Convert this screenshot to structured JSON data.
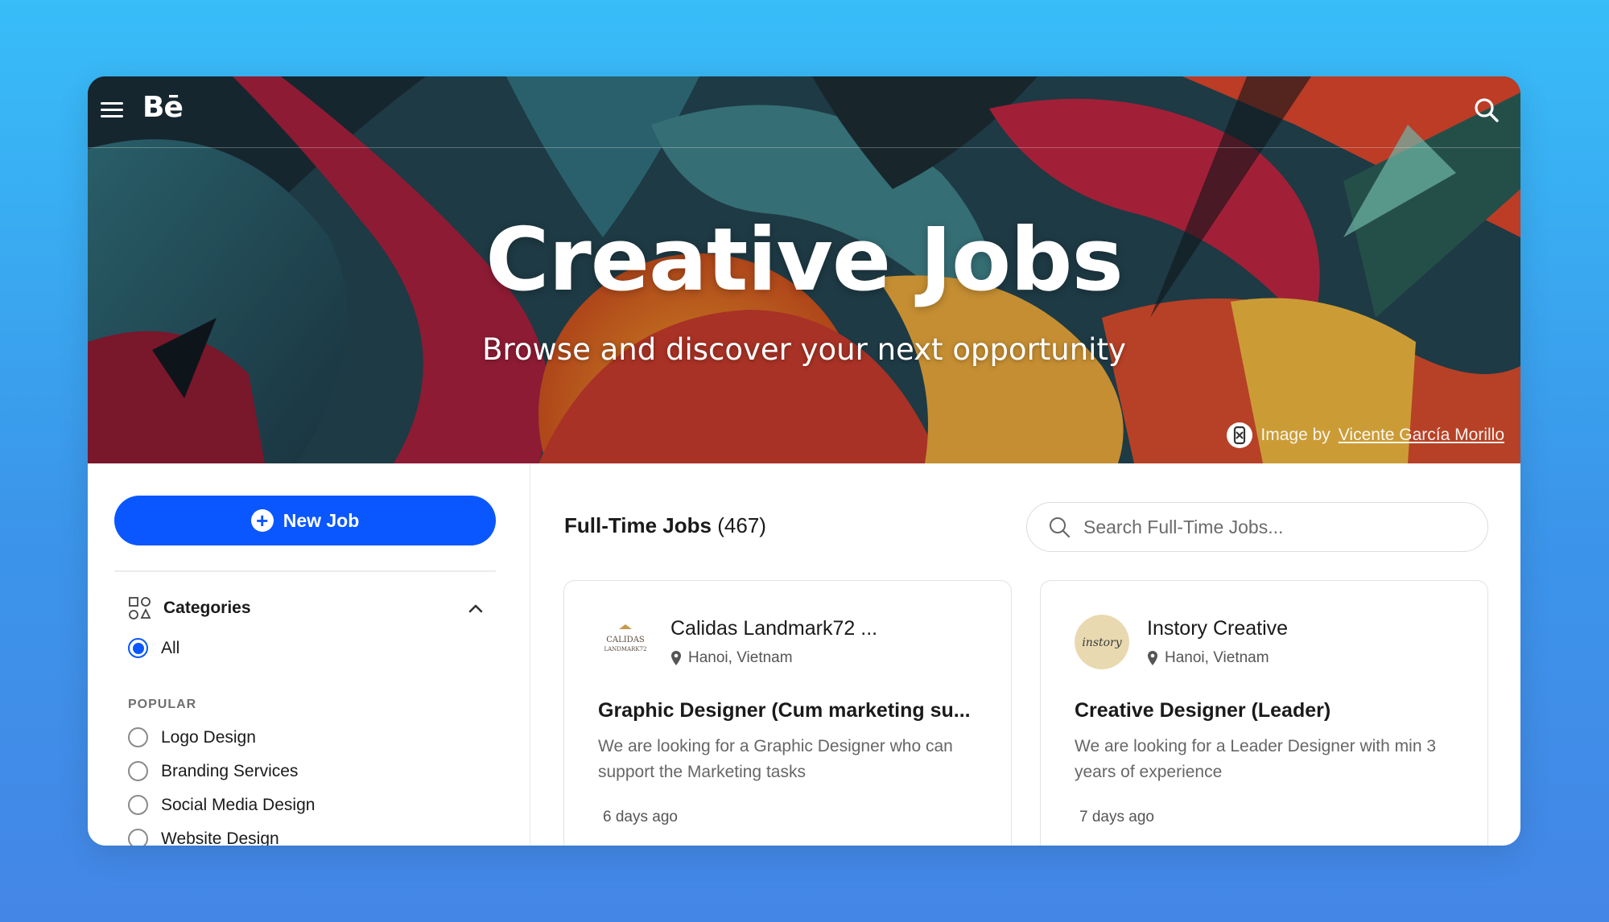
{
  "header": {
    "logo": "Bē"
  },
  "hero": {
    "title": "Creative Jobs",
    "subtitle": "Browse and discover your next opportunity",
    "credit_prefix": "Image by",
    "credit_author": "Vicente García Morillo"
  },
  "sidebar": {
    "new_job_label": "New Job",
    "categories_title": "Categories",
    "all_label": "All",
    "popular_heading": "POPULAR",
    "popular_items": [
      "Logo Design",
      "Branding Services",
      "Social Media Design",
      "Website Design"
    ]
  },
  "main": {
    "section_title": "Full-Time Jobs",
    "section_count": "(467)",
    "search_placeholder": "Search Full-Time Jobs...",
    "cards": [
      {
        "company": "Calidas Landmark72 ...",
        "logo_text": "CALIDAS LANDMARK72",
        "location": "Hanoi, Vietnam",
        "role": "Graphic Designer (Cum marketing su...",
        "description": "We are looking for a Graphic Designer who can support the Marketing tasks",
        "posted": "6 days ago"
      },
      {
        "company": "Instory Creative",
        "logo_text": "instory",
        "location": "Hanoi, Vietnam",
        "role": "Creative Designer (Leader)",
        "description": "We are looking for a Leader Designer with min 3 years of experience",
        "posted": "7 days ago"
      }
    ]
  },
  "colors": {
    "accent": "#0a57ff",
    "background_top": "#38bdf8",
    "background_bottom": "#4486e6"
  }
}
